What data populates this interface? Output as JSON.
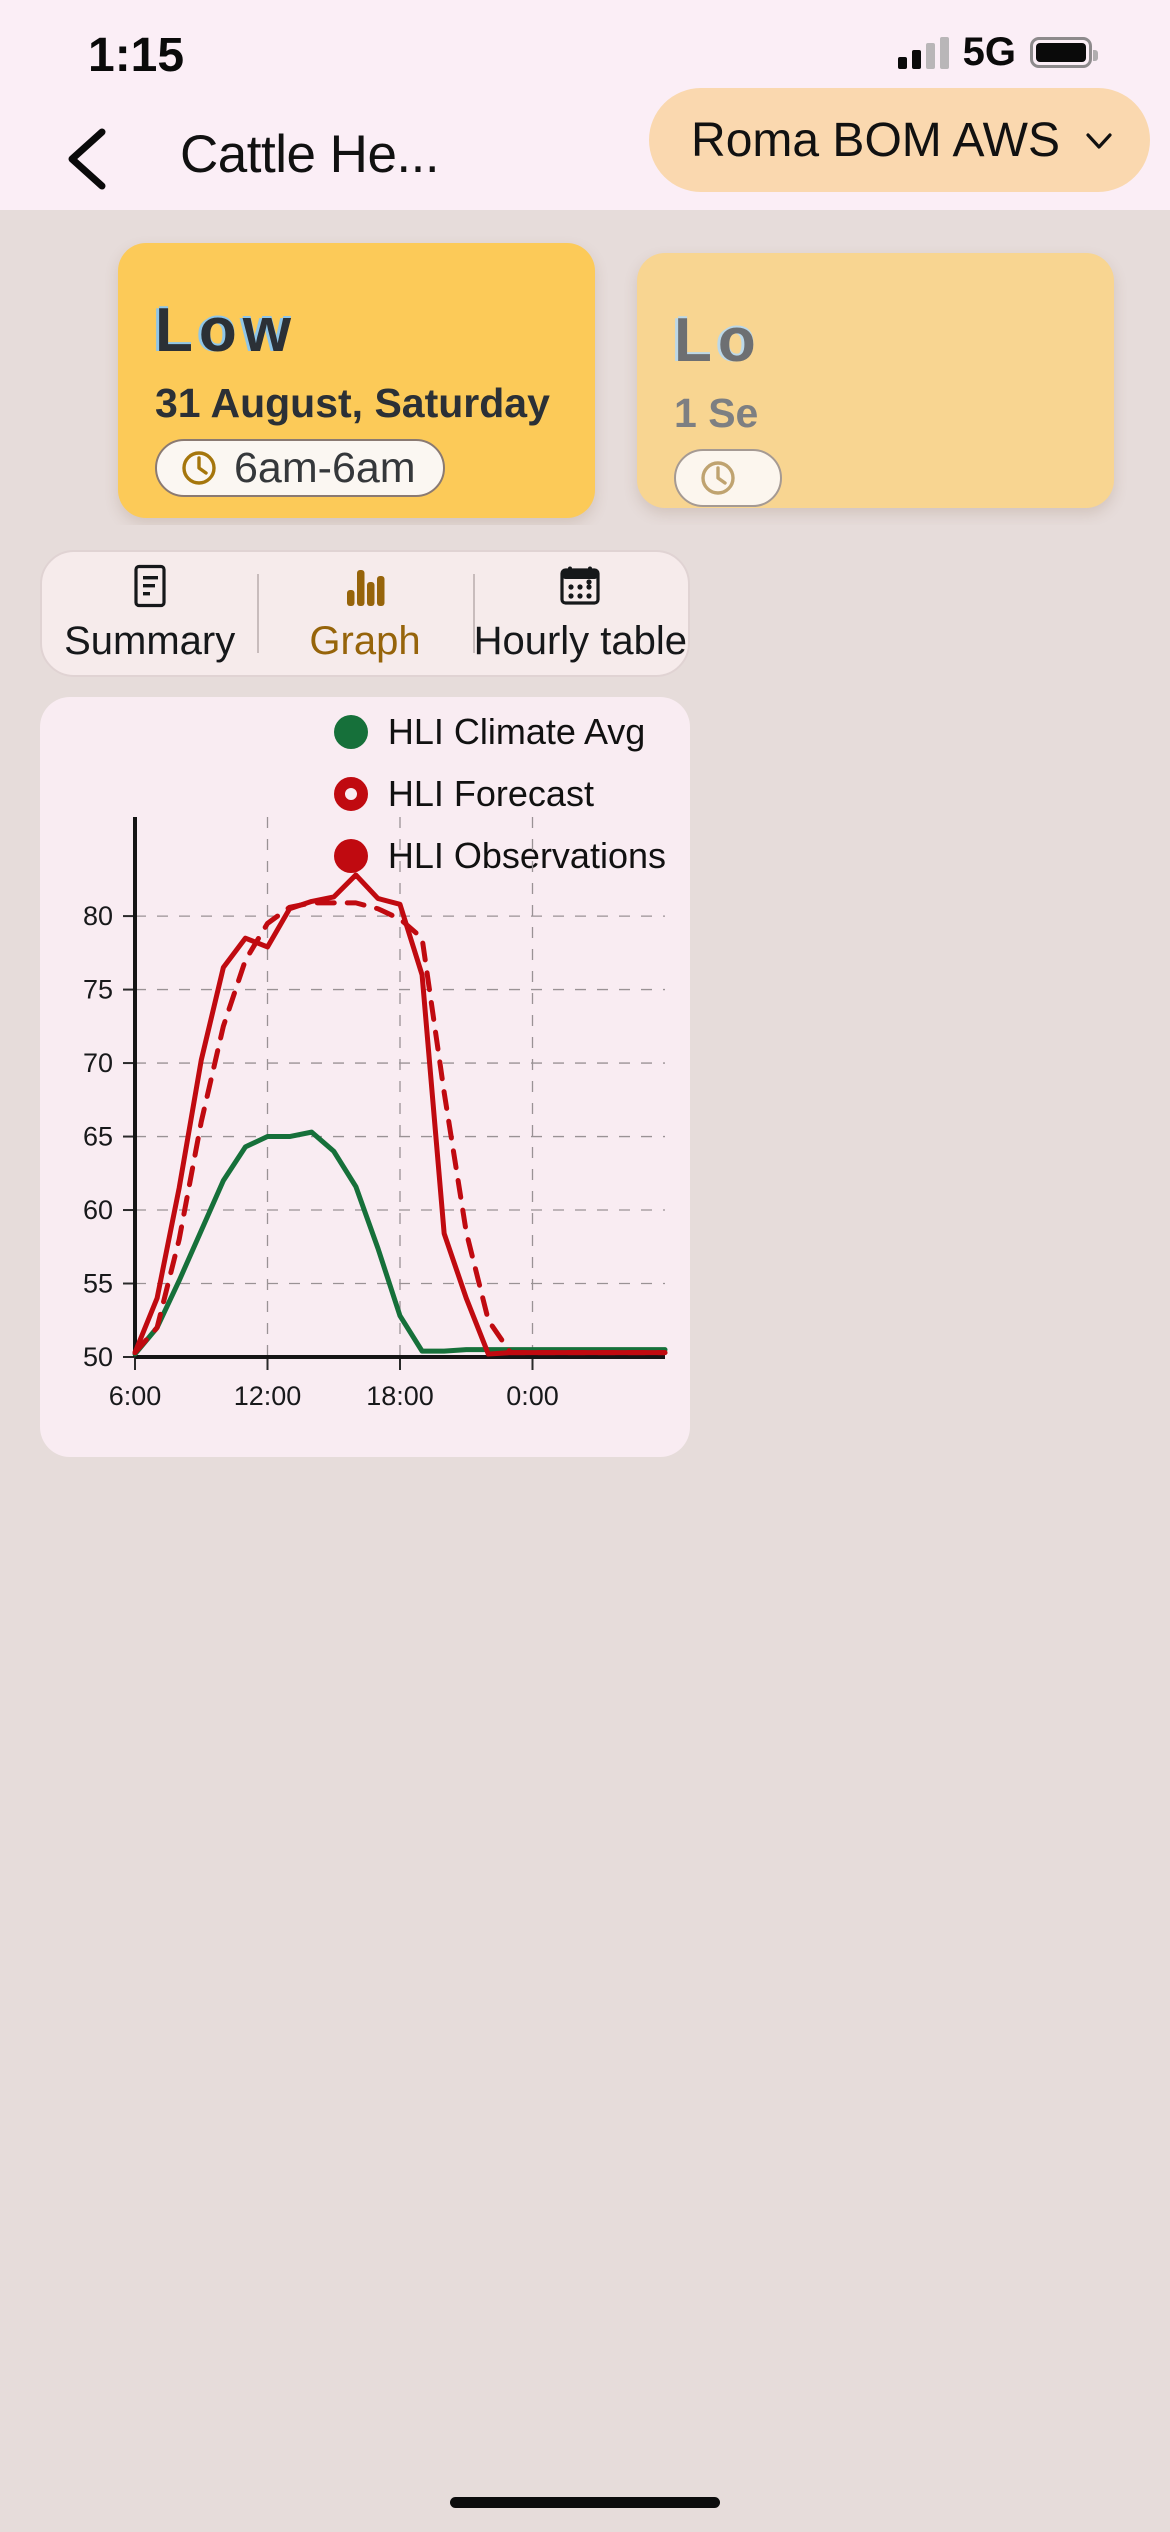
{
  "status_bar": {
    "time": "1:15",
    "network": "5G",
    "signal_icon": "cellular-bars-icon",
    "battery_icon": "battery-full-icon"
  },
  "header": {
    "back_icon": "chevron-left-icon",
    "title": "Cattle He...",
    "station": {
      "label": "Roma BOM AWS",
      "chevron_icon": "chevron-down-icon"
    }
  },
  "day_cards": [
    {
      "level": "Low",
      "date": "31 August, Saturday",
      "time_range": "6am-6am",
      "clock_icon": "clock-icon"
    },
    {
      "level": "Lo",
      "date": "1 Se",
      "time_range": "",
      "clock_icon": "clock-icon"
    }
  ],
  "tabs": [
    {
      "label": "Summary",
      "icon": "document-icon",
      "active": false
    },
    {
      "label": "Graph",
      "icon": "bar-chart-icon",
      "active": true
    },
    {
      "label": "Hourly table",
      "icon": "calendar-icon",
      "active": false
    }
  ],
  "colors": {
    "accent_gold": "#96640a",
    "card_yellow": "#fcca58",
    "card_yellow_faded": "#f8d591",
    "station_pill": "#fad8af",
    "climate_avg_green": "#16703a",
    "forecast_red": "#c00a10",
    "observations_red": "#c00a10",
    "page_background": "#e6dcda",
    "header_background": "#fbeef6",
    "chart_background": "#f9ecf2"
  },
  "chart_data": {
    "type": "line",
    "title": "",
    "xlabel": "",
    "ylabel": "",
    "xlim": [
      6,
      30
    ],
    "ylim": [
      50,
      83
    ],
    "grid": true,
    "legend_position": "top-right",
    "x_ticks": [
      "6:00",
      "12:00",
      "18:00",
      "0:00"
    ],
    "x_tick_values": [
      6,
      12,
      18,
      24
    ],
    "y_ticks": [
      "50",
      "55",
      "60",
      "65",
      "70",
      "75",
      "80"
    ],
    "y_tick_values": [
      50,
      55,
      60,
      65,
      70,
      75,
      80
    ],
    "x": [
      6,
      7,
      8,
      9,
      10,
      11,
      12,
      13,
      14,
      15,
      16,
      17,
      18,
      19,
      20,
      21,
      22,
      23,
      24,
      25,
      26,
      27,
      28,
      29,
      30
    ],
    "series": [
      {
        "name": "HLI Climate Avg",
        "color": "#16703a",
        "style": "solid",
        "marker": "filled-circle",
        "values": [
          50.2,
          52.0,
          55.2,
          58.6,
          62.0,
          64.3,
          65.0,
          65.0,
          65.3,
          64.0,
          61.6,
          57.4,
          52.8,
          50.4,
          50.4,
          50.5,
          50.5,
          50.5,
          50.5,
          50.5,
          50.5,
          50.5,
          50.5,
          50.5,
          50.5
        ]
      },
      {
        "name": "HLI Observations",
        "color": "#c00a10",
        "style": "solid",
        "marker": "filled-circle",
        "values": [
          50.3,
          54.0,
          61.5,
          70.2,
          76.5,
          78.5,
          77.9,
          80.5,
          81.0,
          81.3,
          82.8,
          81.2,
          80.8,
          76.0,
          58.4,
          54.0,
          50.2,
          50.3,
          50.3,
          50.3,
          50.3,
          50.3,
          50.3,
          50.3,
          50.3
        ]
      },
      {
        "name": "HLI Forecast",
        "color": "#c00a10",
        "style": "dashed",
        "marker": "open-circle",
        "values": [
          50.3,
          52.0,
          58.0,
          66.0,
          72.5,
          77.0,
          79.5,
          80.6,
          80.9,
          80.9,
          80.9,
          80.5,
          79.8,
          78.5,
          68.0,
          58.5,
          52.5,
          50.3,
          50.3,
          50.3,
          50.3,
          50.3,
          50.3,
          50.3,
          50.3
        ]
      }
    ]
  },
  "home_indicator": "home-bar"
}
